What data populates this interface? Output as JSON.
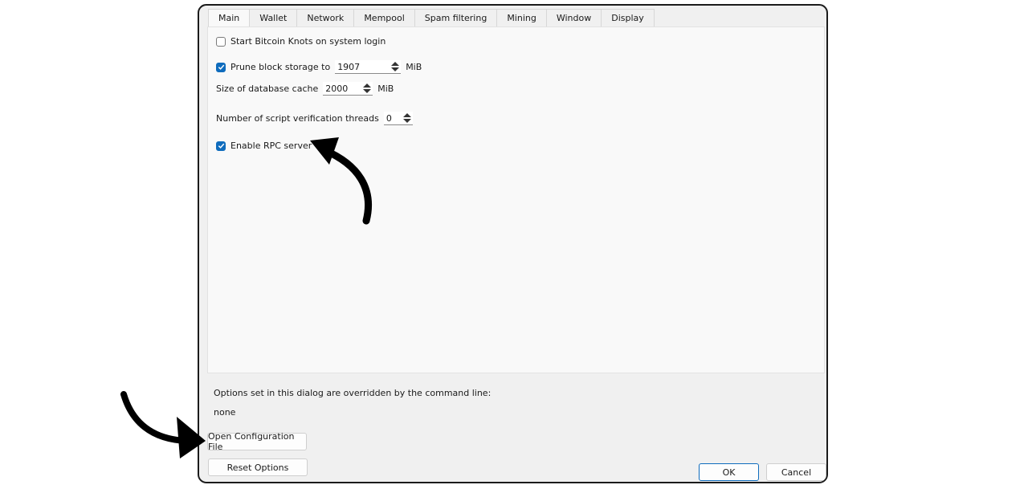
{
  "tabs": [
    {
      "label": "Main",
      "active": true
    },
    {
      "label": "Wallet"
    },
    {
      "label": "Network"
    },
    {
      "label": "Mempool"
    },
    {
      "label": "Spam filtering"
    },
    {
      "label": "Mining"
    },
    {
      "label": "Window"
    },
    {
      "label": "Display"
    }
  ],
  "main": {
    "start_on_login": {
      "label": "Start Bitcoin Knots on system login",
      "checked": false
    },
    "prune": {
      "label": "Prune block storage to",
      "value": "1907",
      "unit": "MiB",
      "checked": true
    },
    "db_cache": {
      "label": "Size of database cache",
      "value": "2000",
      "unit": "MiB"
    },
    "threads": {
      "label": "Number of script verification threads",
      "value": "0"
    },
    "rpc_server": {
      "label": "Enable RPC server",
      "checked": true
    }
  },
  "footer": {
    "override_note": "Options set in this dialog are overridden by the command line:",
    "override_value": "none",
    "open_config_label": "Open Configuration File",
    "reset_label": "Reset Options",
    "ok_label": "OK",
    "cancel_label": "Cancel"
  },
  "colors": {
    "accent": "#0f6cbd",
    "annotation": "#000000"
  }
}
